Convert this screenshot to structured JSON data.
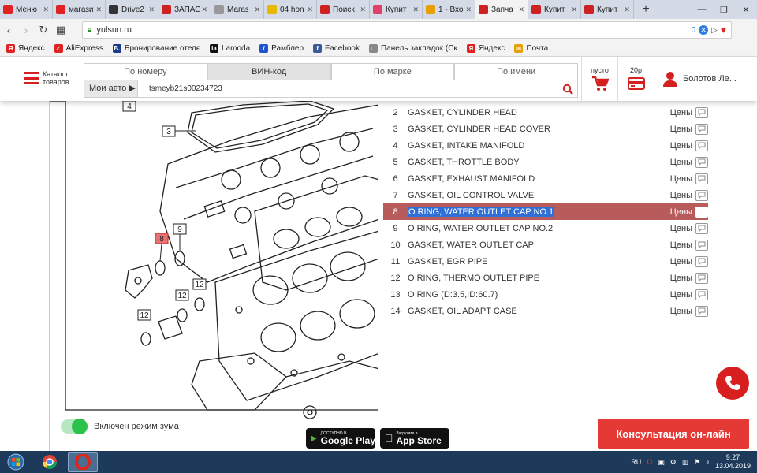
{
  "browser": {
    "tabs": [
      {
        "label": "Меню",
        "color": "#e02222",
        "active": false
      },
      {
        "label": "магази",
        "color": "#e02222",
        "active": false
      },
      {
        "label": "Drive2",
        "color": "#333333",
        "active": false
      },
      {
        "label": "ЗАПАС",
        "color": "#cc2222",
        "active": false
      },
      {
        "label": "Магаз",
        "color": "#999999",
        "active": false
      },
      {
        "label": "04 hon",
        "color": "#e6b800",
        "active": false
      },
      {
        "label": "Поиск",
        "color": "#cc2222",
        "active": false
      },
      {
        "label": "Купит",
        "color": "#e0406a",
        "active": false
      },
      {
        "label": "1 - Вхо",
        "color": "#e8a000",
        "active": false
      },
      {
        "label": "Запча",
        "color": "#cc2222",
        "active": true
      },
      {
        "label": "Купит",
        "color": "#cc2222",
        "active": false
      },
      {
        "label": "Купит",
        "color": "#cc2222",
        "active": false
      }
    ],
    "url": "yulsun.ru",
    "url_badge": "0",
    "bookmarks": [
      {
        "label": "Яндекс",
        "color": "#e02222",
        "glyph": "Я"
      },
      {
        "label": "AliExpress",
        "color": "#e02222",
        "glyph": "✓"
      },
      {
        "label": "Бронирование отелє",
        "color": "#1a3a8a",
        "glyph": "B."
      },
      {
        "label": "Lamoda",
        "color": "#111111",
        "glyph": "la"
      },
      {
        "label": "Рамблер",
        "color": "#2255cc",
        "glyph": "/"
      },
      {
        "label": "Facebook",
        "color": "#3b5998",
        "glyph": "f"
      },
      {
        "label": "Панель закладок (Ск",
        "color": "#888888",
        "glyph": "□"
      },
      {
        "label": "Яндекс",
        "color": "#e02222",
        "glyph": "Я"
      },
      {
        "label": "Почта",
        "color": "#e8a000",
        "glyph": "✉"
      }
    ]
  },
  "header": {
    "catalog_line1": "Каталог",
    "catalog_line2": "товаров",
    "search_tabs": [
      "По номеру",
      "ВИН-код",
      "По марке",
      "По имени"
    ],
    "active_tab": 1,
    "my_auto": "Мои авто ▶",
    "vin_value": "tsmeyb21s00234723",
    "cart_label": "пусто",
    "wallet_label": "20р",
    "user_name": "Болотов Ле..."
  },
  "diagram": {
    "callouts": [
      "4",
      "3",
      "8",
      "9",
      "12",
      "12",
      "12",
      "12"
    ],
    "zoom_label": "Включен режим зума",
    "google_play_small": "ДОСТУПНО В",
    "google_play_big": "Google Play",
    "app_store_small": "Загрузите в",
    "app_store_big": "App Store"
  },
  "parts": {
    "price_label": "Цены",
    "selected_index": 6,
    "rows": [
      {
        "num": "2",
        "name": "GASKET, CYLINDER HEAD"
      },
      {
        "num": "3",
        "name": "GASKET, CYLINDER HEAD COVER"
      },
      {
        "num": "4",
        "name": "GASKET, INTAKE MANIFOLD"
      },
      {
        "num": "5",
        "name": "GASKET, THROTTLE BODY"
      },
      {
        "num": "6",
        "name": "GASKET, EXHAUST MANIFOLD"
      },
      {
        "num": "7",
        "name": "GASKET, OIL CONTROL VALVE"
      },
      {
        "num": "8",
        "name": "O RING, WATER OUTLET CAP NO.1"
      },
      {
        "num": "9",
        "name": "O RING, WATER OUTLET CAP NO.2"
      },
      {
        "num": "10",
        "name": "GASKET, WATER OUTLET CAP"
      },
      {
        "num": "11",
        "name": "GASKET, EGR PIPE"
      },
      {
        "num": "12",
        "name": "O RING, THERMO OUTLET PIPE"
      },
      {
        "num": "13",
        "name": "O RING (D:3.5,ID:60.7)"
      },
      {
        "num": "14",
        "name": "GASKET, OIL ADAPT CASE"
      }
    ]
  },
  "consult_label": "Консультация он-лайн",
  "taskbar": {
    "lang": "RU",
    "time": "9:27",
    "date": "13.04.2019"
  }
}
